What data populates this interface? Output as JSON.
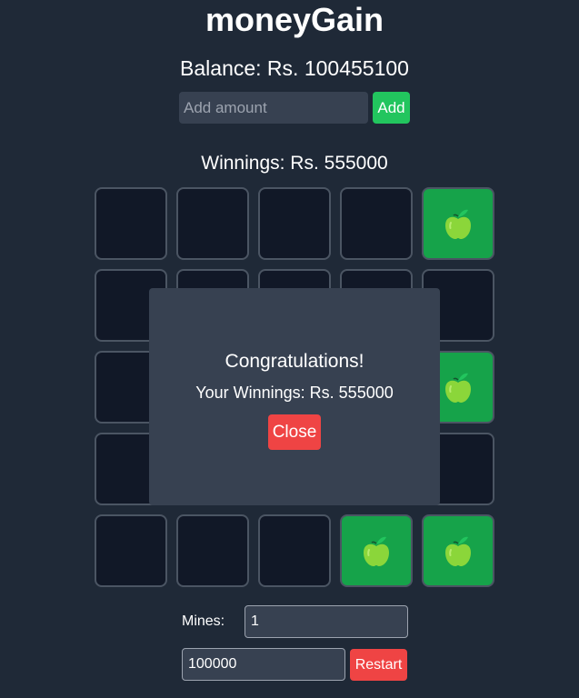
{
  "app": {
    "title": "moneyGain"
  },
  "balance": {
    "text": "Balance: Rs. 100455100"
  },
  "add_amount": {
    "placeholder": "Add amount",
    "value": "",
    "button_label": "Add"
  },
  "winnings": {
    "text": "Winnings: Rs. 555000"
  },
  "board": {
    "rows": 5,
    "cols": 5,
    "tiles": [
      "hidden",
      "hidden",
      "hidden",
      "hidden",
      "apple",
      "hidden",
      "hidden",
      "hidden",
      "hidden",
      "hidden",
      "hidden",
      "hidden",
      "hidden",
      "hidden",
      "apple",
      "hidden",
      "hidden",
      "hidden",
      "hidden",
      "hidden",
      "hidden",
      "hidden",
      "hidden",
      "apple",
      "apple"
    ],
    "revealed_icon": "apple-icon"
  },
  "modal": {
    "title": "Congratulations!",
    "message": "Your Winnings: Rs. 555000",
    "close_label": "Close"
  },
  "controls": {
    "mines_label": "Mines:",
    "mines_value": "1",
    "bet_value": "100000",
    "restart_label": "Restart"
  },
  "colors": {
    "background": "#1f2937",
    "tile_hidden": "#111827",
    "tile_revealed": "#16a34a",
    "accent_green": "#22c55e",
    "accent_red": "#ef4444",
    "panel": "#374151",
    "apple": "#8bd63a"
  }
}
